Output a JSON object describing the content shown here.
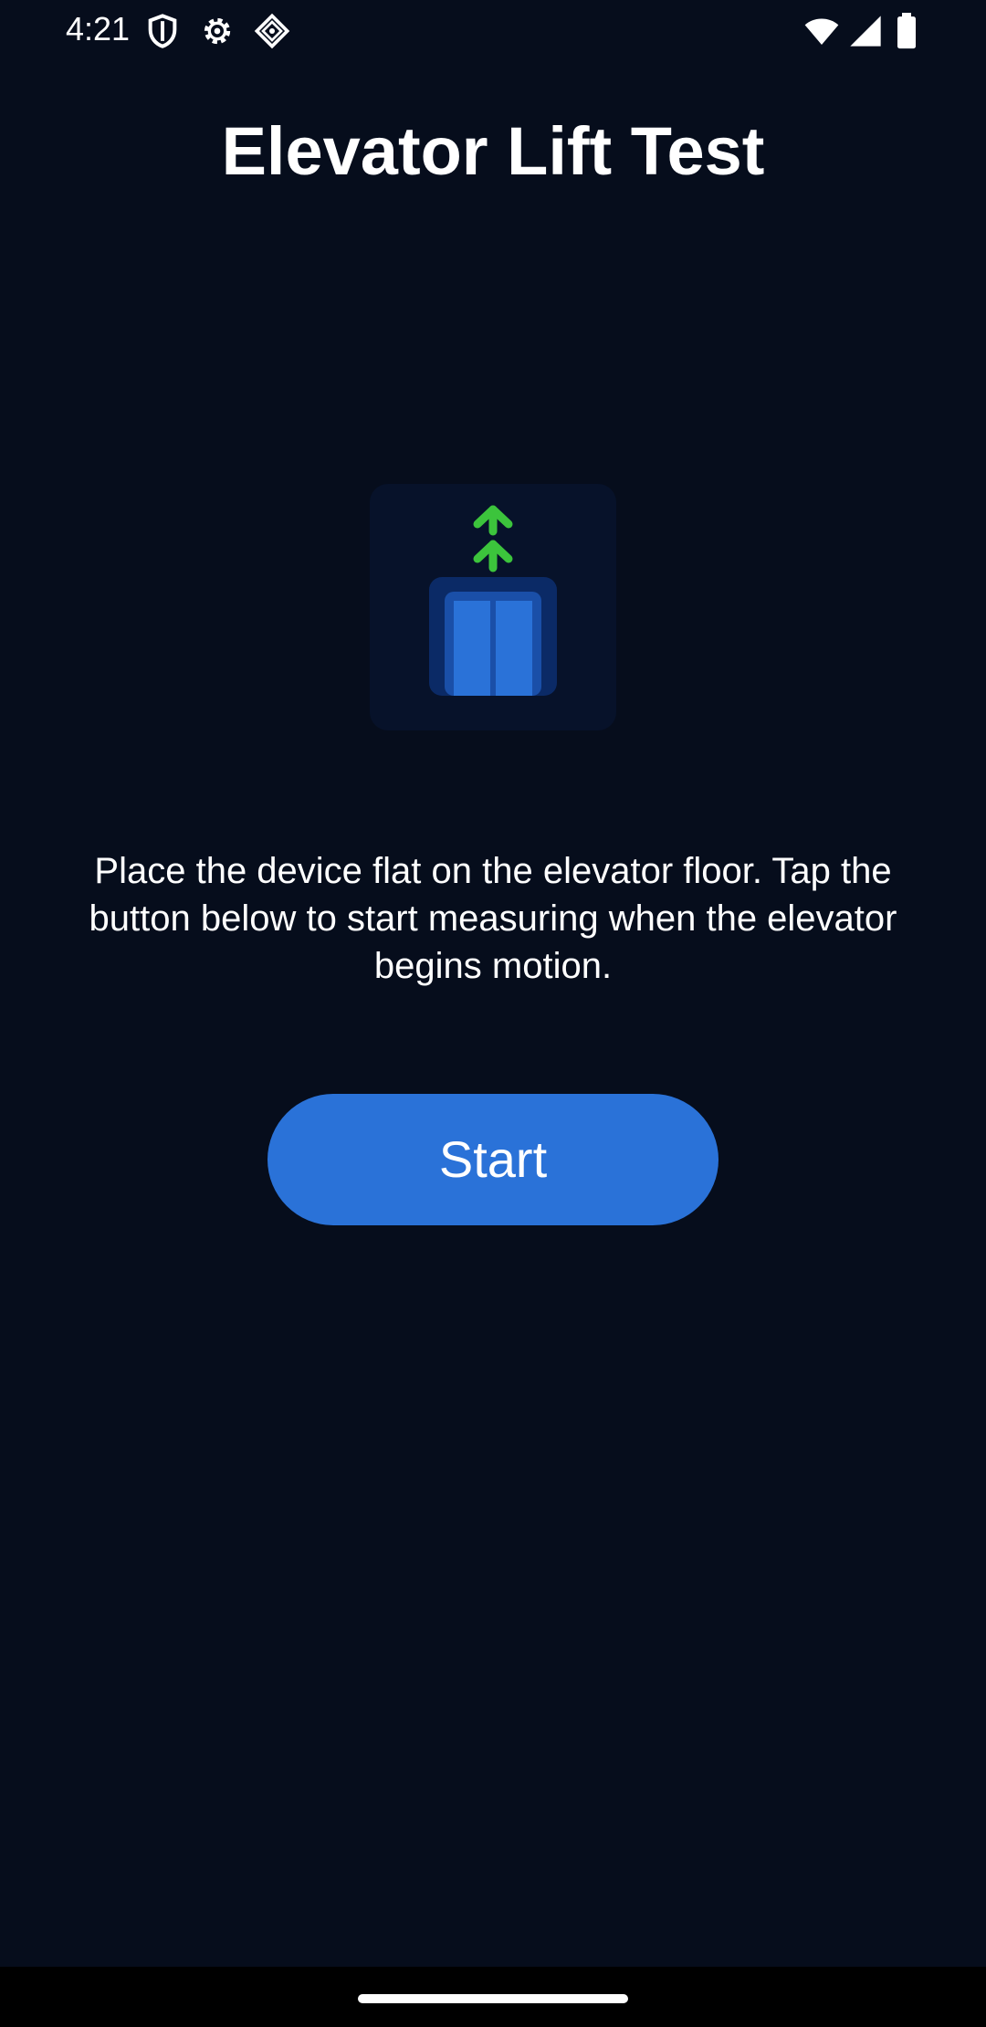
{
  "status_bar": {
    "time": "4:21",
    "left_icons": [
      "shield-icon",
      "gear-icon",
      "diamond-icon"
    ],
    "right_icons": [
      "wifi-icon",
      "signal-icon",
      "battery-icon"
    ]
  },
  "page": {
    "title": "Elevator Lift Test",
    "hero_icon": "elevator-up-icon",
    "instructions": "Place the device flat on the elevator floor. Tap the button below to start measuring when the elevator begins motion.",
    "start_label": "Start"
  },
  "colors": {
    "background": "#060d1c",
    "accent": "#2a72d8",
    "arrow": "#3cc43c",
    "elevator_frame": "#0b2a66",
    "elevator_door": "#2a72d8"
  }
}
